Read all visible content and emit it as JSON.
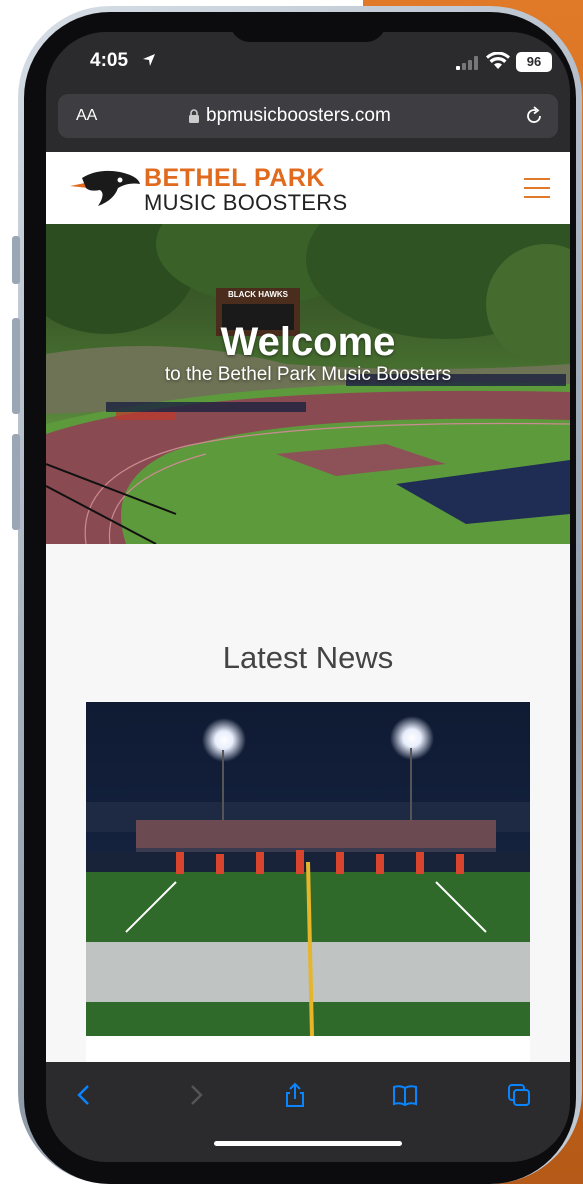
{
  "status_bar": {
    "time": "4:05",
    "battery": "96"
  },
  "browser": {
    "text_size_label": "AA",
    "url": "bpmusicboosters.com"
  },
  "site": {
    "logo_top": "BETHEL PARK",
    "logo_bottom": "MUSIC BOOSTERS"
  },
  "hero": {
    "title": "Welcome",
    "subtitle": "to the Bethel Park Music Boosters",
    "scoreboard": "BLACK HAWKS"
  },
  "news": {
    "heading": "Latest News"
  },
  "toolbar": {
    "icons": [
      "back-icon",
      "forward-icon",
      "share-icon",
      "bookmarks-icon",
      "tabs-icon"
    ]
  },
  "colors": {
    "brand_orange": "#e06a1d",
    "ios_blue": "#0a84ff",
    "bar_bg": "#2b2b2e"
  }
}
